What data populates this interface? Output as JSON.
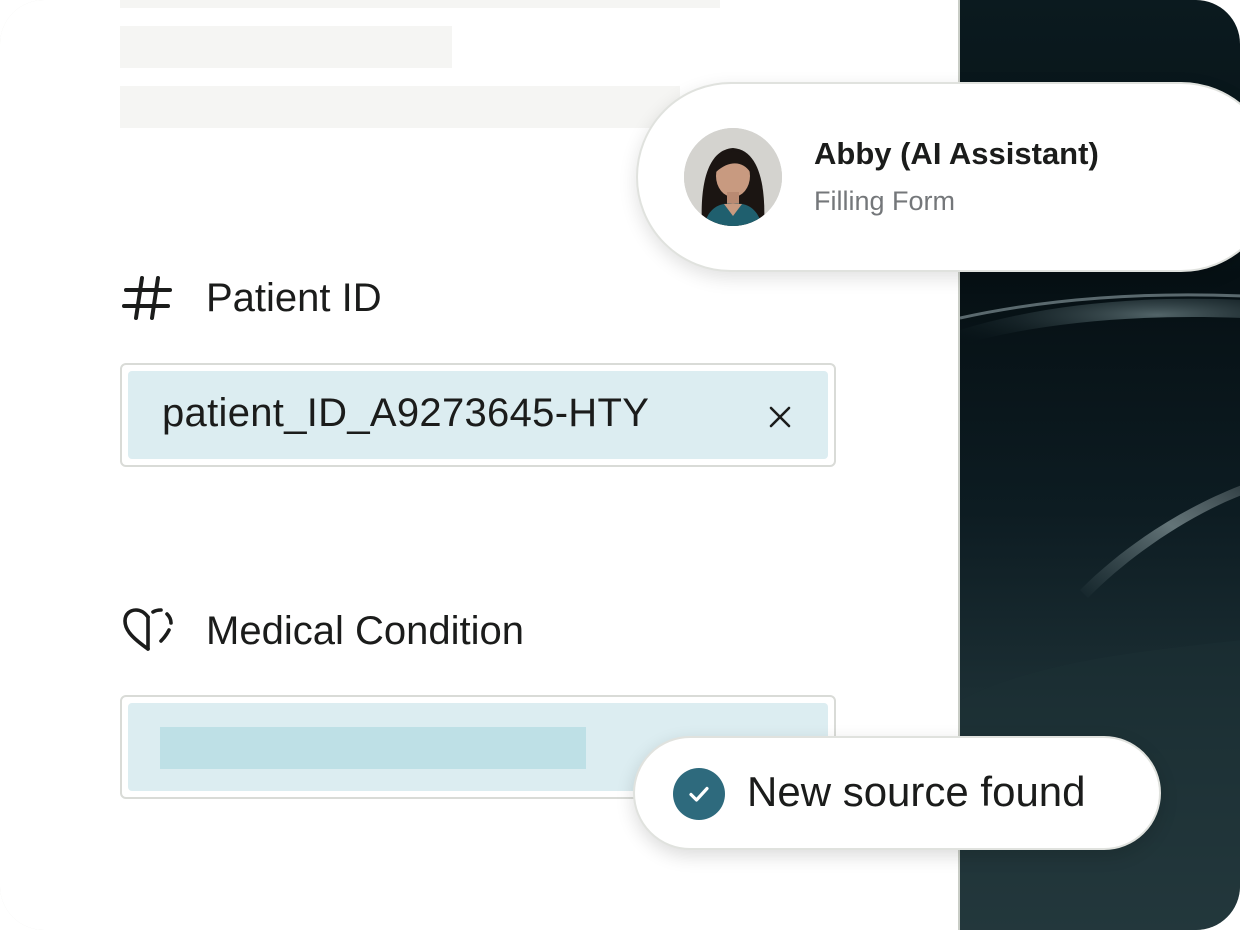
{
  "assistant": {
    "name": "Abby (AI Assistant)",
    "status": "Filling Form",
    "avatar_icon": "person-avatar"
  },
  "form": {
    "patient_id": {
      "label": "Patient ID",
      "icon": "hash-icon",
      "value": "patient_ID_A9273645-HTY",
      "clear_icon": "close-icon"
    },
    "medical_condition": {
      "label": "Medical Condition",
      "icon": "heart-icon",
      "value": ""
    }
  },
  "toast": {
    "text": "New source found",
    "icon": "check-circle-icon"
  },
  "colors": {
    "field_fill": "#dcedf1",
    "skeleton_fill": "#bee0e6",
    "accent": "#2e6a7d",
    "dark_panel": "#0b1a1f"
  }
}
